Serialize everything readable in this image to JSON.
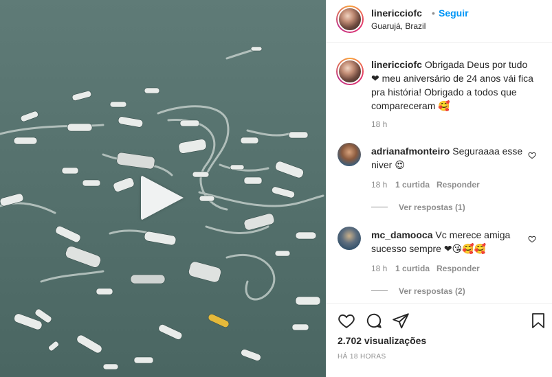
{
  "header": {
    "username": "linericciofc",
    "separator": "•",
    "follow_label": "Seguir",
    "location": "Guarujá, Brazil"
  },
  "caption": {
    "username": "linericciofc",
    "text": "Obrigada Deus por tudo ❤ meu aniversário de 24 anos vái fica pra história! Obrigado a todos que compareceram 🥰",
    "time": "18 h"
  },
  "comments": [
    {
      "username": "adrianafmonteiro",
      "text": "Seguraaaa esse niver 😍",
      "time": "18 h",
      "likes": "1 curtida",
      "reply_label": "Responder",
      "view_replies": "Ver respostas (1)"
    },
    {
      "username": "mc_damooca",
      "text": "Vc merece amiga sucesso sempre ❤😘🥰🥰",
      "time": "18 h",
      "likes": "1 curtida",
      "reply_label": "Responder",
      "view_replies": "Ver respostas (2)"
    }
  ],
  "stats": {
    "views": "2.702 visualizações",
    "time_ago": "HÁ 18 HORAS"
  },
  "icons": {
    "like": "heart-icon",
    "comment": "comment-icon",
    "share": "share-icon",
    "save": "bookmark-icon",
    "play": "play-icon"
  },
  "colors": {
    "link": "#0095f6",
    "muted": "#8e8e8e",
    "text": "#262626",
    "water": "#4f6d6a"
  }
}
